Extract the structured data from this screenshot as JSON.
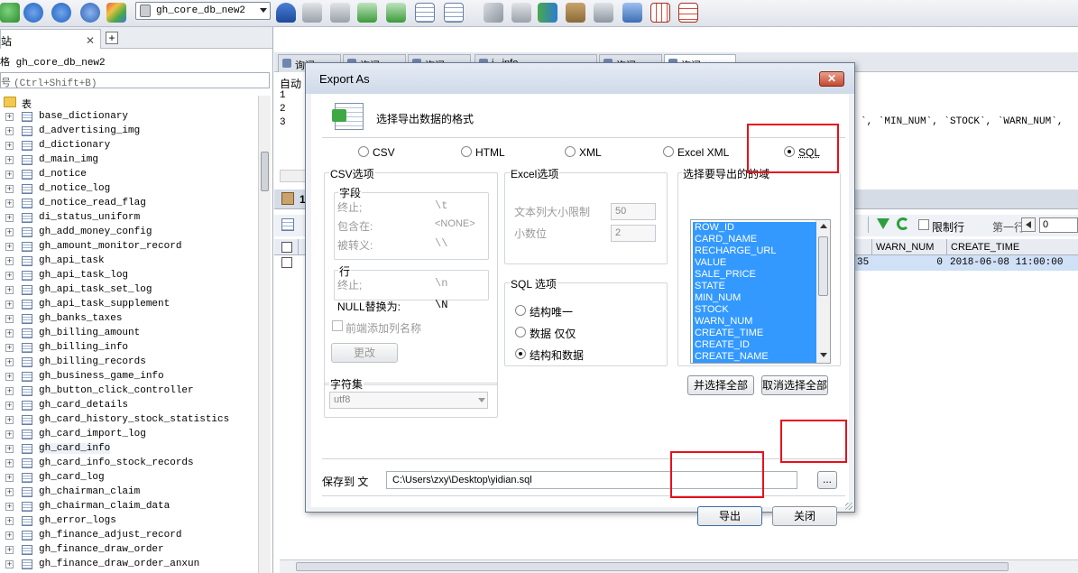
{
  "toolbar": {
    "database_select": "gh_core_db_new2",
    "icons": [
      "refresh-icon",
      "play-icon",
      "fast-forward-icon",
      "connect-icon",
      "tools-icon",
      "user-icon",
      "db-add-icon",
      "db-add-2-icon",
      "db-import-icon",
      "db-export-icon",
      "table-icon",
      "table-lock-icon",
      "backup-icon",
      "db-sync-icon",
      "compare-icon",
      "transfer-icon",
      "schedule-icon",
      "monitor-icon",
      "grid-icon",
      "schema-icon"
    ]
  },
  "left": {
    "tab_label": "站",
    "tab_close": "✕",
    "new_tab": "+",
    "connection_label": "格 gh_core_db_new2",
    "filter_placeholder": "(Ctrl+Shift+B)",
    "filter_prefix": "号",
    "folder_label": "表",
    "tables": [
      "base_dictionary",
      "d_advertising_img",
      "d_dictionary",
      "d_main_img",
      "d_notice",
      "d_notice_log",
      "d_notice_read_flag",
      "di_status_uniform",
      "gh_add_money_config",
      "gh_amount_monitor_record",
      "gh_api_task",
      "gh_api_task_log",
      "gh_api_task_set_log",
      "gh_api_task_supplement",
      "gh_banks_taxes",
      "gh_billing_amount",
      "gh_billing_info",
      "gh_billing_records",
      "gh_business_game_info",
      "gh_button_click_controller",
      "gh_card_details",
      "gh_card_history_stock_statistics",
      "gh_card_import_log",
      "gh_card_info",
      "gh_card_info_stock_records",
      "gh_card_log",
      "gh_chairman_claim",
      "gh_chairman_claim_data",
      "gh_error_logs",
      "gh_finance_adjust_record",
      "gh_finance_draw_order",
      "gh_finance_draw_order_anxun"
    ]
  },
  "right": {
    "query_tabs": [
      "询问",
      "询问",
      "询问",
      "i...info",
      "询问",
      "询问 ✕"
    ],
    "editor_auto": "自动",
    "line_numbers": [
      "1",
      "2",
      "3"
    ],
    "editor_code": "`, `MIN_NUM`, `STOCK`, `WARN_NUM`,",
    "result_tab": "1",
    "limit_label": "限制行",
    "first_row_label": "第一行:",
    "first_row_value": "0",
    "grid_headers": [
      "WARN_NUM",
      "CREATE_TIME"
    ],
    "grid_row": {
      "prev_value": "35",
      "warn_num": "0",
      "create_time": "2018-06-08 11:00:00"
    }
  },
  "dialog": {
    "title": "Export As",
    "close": "✕",
    "header": "选择导出数据的格式",
    "formats": [
      "CSV",
      "HTML",
      "XML",
      "Excel XML",
      "SQL"
    ],
    "selected_format": "SQL",
    "csv": {
      "title": "CSV选项",
      "field_group": "字段",
      "terminated_label": "终止;",
      "terminated_value": "\\t",
      "enclosed_label": "包含在:",
      "enclosed_value": "<NONE>",
      "escaped_label": "被转义:",
      "escaped_value": "\\\\",
      "line_group": "行",
      "line_terminated_label": "终止;",
      "line_terminated_value": "\\n",
      "null_label": "NULL替换为:",
      "null_value": "\\N",
      "add_header_label": "前端添加列名称",
      "change_button": "更改"
    },
    "excel": {
      "title": "Excel选项",
      "text_limit_label": "文本列大小限制",
      "text_limit_value": "50",
      "decimals_label": "小数位",
      "decimals_value": "2"
    },
    "sql": {
      "title": "SQL 选项",
      "options": [
        "结构唯一",
        "数据 仅仅",
        "结构和数据"
      ],
      "selected": "结构和数据"
    },
    "fields": {
      "title": "选择要导出的的域",
      "items": [
        "ROW_ID",
        "CARD_NAME",
        "RECHARGE_URL",
        "VALUE",
        "SALE_PRICE",
        "STATE",
        "MIN_NUM",
        "STOCK",
        "WARN_NUM",
        "CREATE_TIME",
        "CREATE_ID",
        "CREATE_NAME"
      ],
      "select_all": "并选择全部",
      "deselect_all": "取消选择全部"
    },
    "charset": {
      "title": "字符集",
      "value": "utf8"
    },
    "save": {
      "label": "保存到 文",
      "path": "C:\\Users\\zxy\\Desktop\\yidian.sql",
      "browse": "..."
    },
    "export_button": "导出",
    "close_button": "关闭"
  },
  "annotations_color": "#e8101a"
}
